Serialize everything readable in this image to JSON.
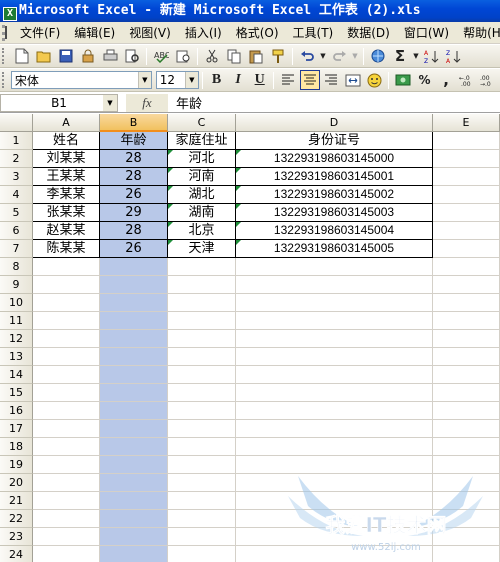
{
  "window": {
    "title": "Microsoft Excel - 新建 Microsoft Excel 工作表 (2).xls"
  },
  "menu": [
    "文件(F)",
    "编辑(E)",
    "视图(V)",
    "插入(I)",
    "格式(O)",
    "工具(T)",
    "数据(D)",
    "窗口(W)",
    "帮助(H)"
  ],
  "toolbar2": {
    "font_name": "宋体",
    "font_size": "12",
    "bold": "B",
    "italic": "I",
    "underline": "U",
    "percent": "%",
    "comma": ","
  },
  "formula_bar": {
    "name_box": "B1",
    "fx": "fx",
    "content": "年龄"
  },
  "columns": [
    "A",
    "B",
    "C",
    "D",
    "E"
  ],
  "rows": [
    "1",
    "2",
    "3",
    "4",
    "5",
    "6",
    "7",
    "8",
    "9",
    "10",
    "11",
    "12",
    "13",
    "14",
    "15",
    "16",
    "17",
    "18",
    "19",
    "20",
    "21",
    "22",
    "23",
    "24"
  ],
  "table": {
    "header": [
      "姓名",
      "年龄",
      "家庭住址",
      "身份证号"
    ],
    "data": [
      [
        "刘某某",
        "28",
        "河北",
        "132293198603145000"
      ],
      [
        "王某某",
        "28",
        "河南",
        "132293198603145001"
      ],
      [
        "李某某",
        "26",
        "湖北",
        "132293198603145002"
      ],
      [
        "张某某",
        "29",
        "湖南",
        "132293198603145003"
      ],
      [
        "赵某某",
        "28",
        "北京",
        "132293198603145004"
      ],
      [
        "陈某某",
        "26",
        "天津",
        "132293198603145005"
      ]
    ]
  },
  "watermark": {
    "text": "我爱IT技术网",
    "url": "www.52ij.com"
  }
}
